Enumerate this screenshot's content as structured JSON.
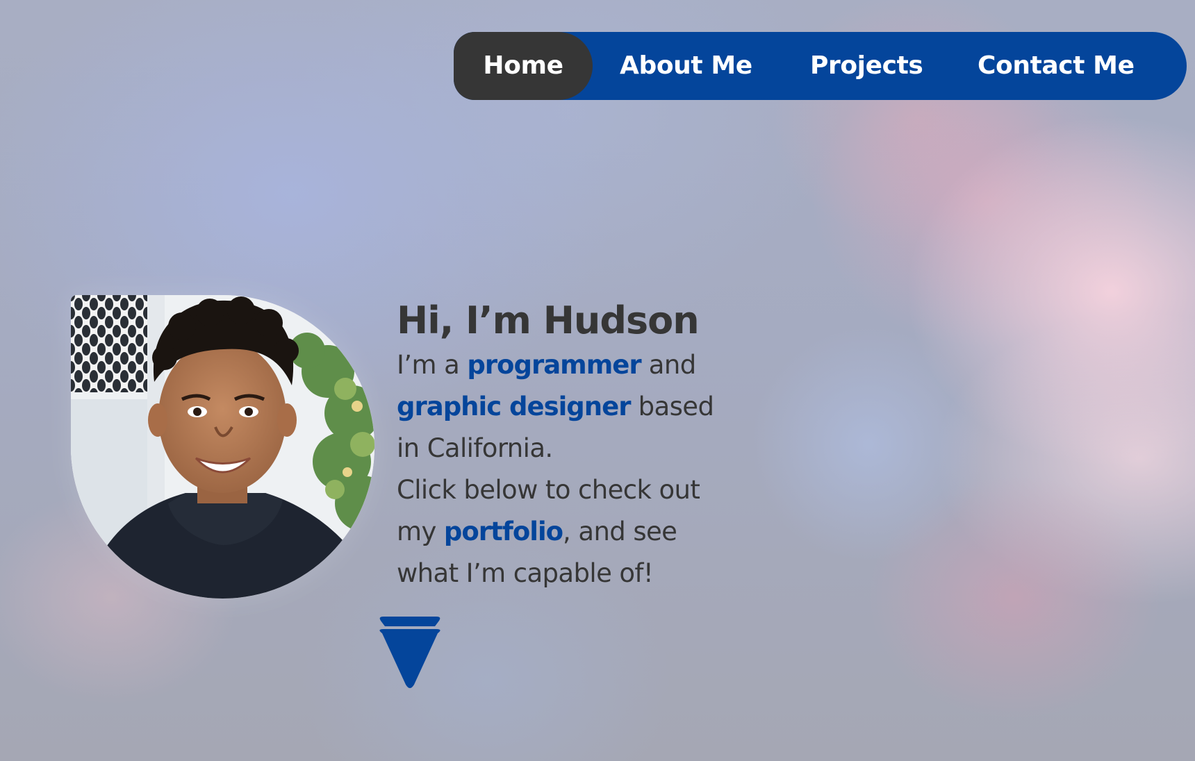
{
  "nav": {
    "items": [
      {
        "label": "Home",
        "active": true
      },
      {
        "label": "About Me",
        "active": false
      },
      {
        "label": "Projects",
        "active": false
      },
      {
        "label": "Contact Me",
        "active": false
      }
    ]
  },
  "hero": {
    "greeting": "Hi, I’m Hudson",
    "bio": {
      "line1_pre": "I’m a ",
      "programmer": "programmer",
      "line1_post": " and",
      "graphic_designer": "graphic designer",
      "line2_post": " based",
      "line3": "in California.",
      "line4": "Click below to check out",
      "line5_pre": "my ",
      "portfolio": "portfolio",
      "line5_post": ", and see",
      "line6": "what I’m capable of!"
    }
  },
  "icons": {
    "scroll_down": "down-arrow-icon",
    "avatar": "profile-photo"
  },
  "colors": {
    "accent": "#04459b",
    "dark": "#363636",
    "nav_text": "#ffffff"
  }
}
